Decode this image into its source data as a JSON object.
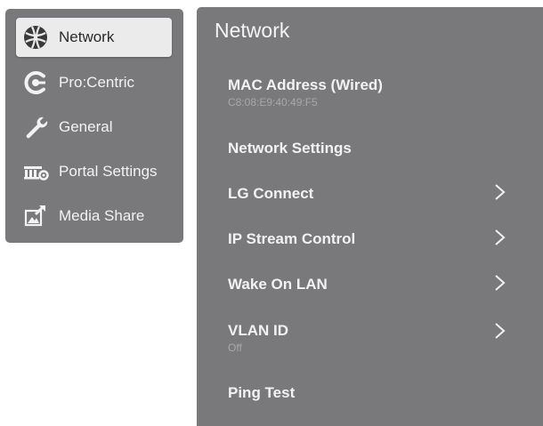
{
  "sidebar": {
    "items": [
      {
        "label": "Network",
        "icon": "globe-icon",
        "selected": true
      },
      {
        "label": "Pro:Centric",
        "icon": "procentric-icon",
        "selected": false
      },
      {
        "label": "General",
        "icon": "wrench-icon",
        "selected": false
      },
      {
        "label": "Portal Settings",
        "icon": "portal-icon",
        "selected": false
      },
      {
        "label": "Media Share",
        "icon": "media-share-icon",
        "selected": false
      }
    ]
  },
  "panel": {
    "title": "Network",
    "items": [
      {
        "label": "MAC Address (Wired)",
        "sub": "C8:08:E9:40:49:F5",
        "chevron": false
      },
      {
        "label": "Network Settings",
        "sub": "",
        "chevron": false
      },
      {
        "label": "LG Connect",
        "sub": "",
        "chevron": true
      },
      {
        "label": "IP Stream Control",
        "sub": "",
        "chevron": true
      },
      {
        "label": "Wake On LAN",
        "sub": "",
        "chevron": true
      },
      {
        "label": "VLAN ID",
        "sub": "Off",
        "chevron": true
      },
      {
        "label": "Ping Test",
        "sub": "",
        "chevron": false
      }
    ]
  },
  "colors": {
    "panel_bg": "#79797b",
    "selected_bg": "#ebebeb",
    "text_light": "#f2f2f2",
    "text_sub": "#a8a8aa"
  }
}
